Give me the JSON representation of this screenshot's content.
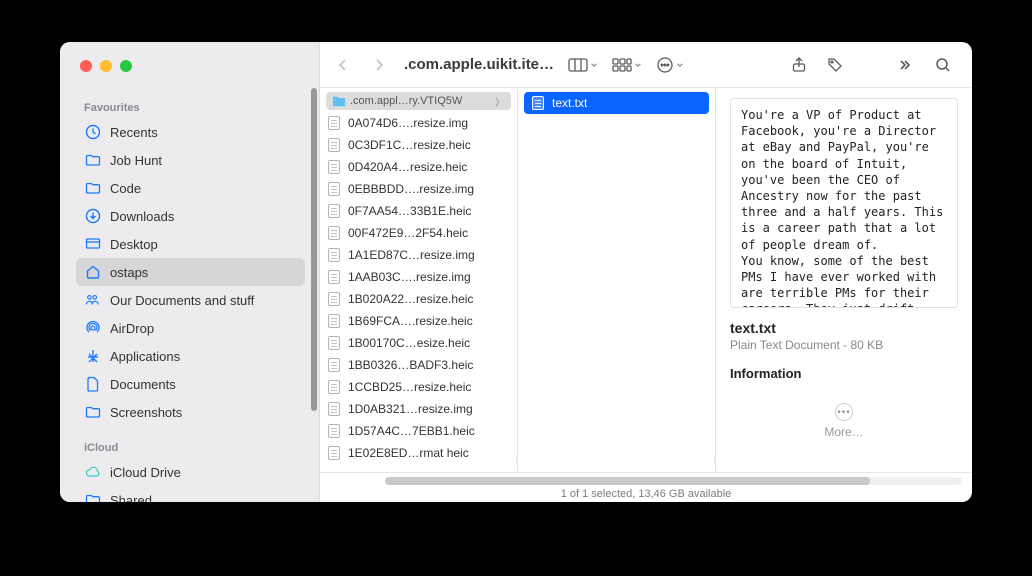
{
  "window_title": ".com.apple.uikit.ite…",
  "sidebar": {
    "sections": [
      {
        "header": "Favourites",
        "items": [
          {
            "icon": "clock",
            "label": "Recents"
          },
          {
            "icon": "folder",
            "label": "Job Hunt"
          },
          {
            "icon": "folder",
            "label": "Code"
          },
          {
            "icon": "download",
            "label": "Downloads"
          },
          {
            "icon": "desktop",
            "label": "Desktop"
          },
          {
            "icon": "home",
            "label": "ostaps",
            "selected": true
          },
          {
            "icon": "people",
            "label": "Our Documents and stuff"
          },
          {
            "icon": "airdrop",
            "label": "AirDrop"
          },
          {
            "icon": "apps",
            "label": "Applications"
          },
          {
            "icon": "doc",
            "label": "Documents"
          },
          {
            "icon": "folder",
            "label": "Screenshots"
          }
        ]
      },
      {
        "header": "iCloud",
        "items": [
          {
            "icon": "cloud",
            "label": "iCloud Drive"
          },
          {
            "icon": "folder",
            "label": "Shared"
          }
        ]
      }
    ]
  },
  "columns": {
    "path_header": ".com.appl…ry.VTIQ5W",
    "col1": [
      "0A074D6….resize.img",
      "0C3DF1C…resize.heic",
      "0D420A4…resize.heic",
      "0EBBBDD….resize.img",
      "0F7AA54…33B1E.heic",
      "00F472E9…2F54.heic",
      "1A1ED87C…resize.img",
      "1AAB03C….resize.img",
      "1B020A22…resize.heic",
      "1B69FCA….resize.heic",
      "1B00170C…esize.heic",
      "1BB0326…BADF3.heic",
      "1CCBD25…resize.heic",
      "1D0AB321…resize.img",
      "1D57A4C…7EBB1.heic",
      "1E02E8ED…rmat heic"
    ],
    "col2": [
      {
        "name": "text.txt",
        "selected": true
      }
    ]
  },
  "preview": {
    "content": "You're a VP of Product at Facebook, you're a Director at eBay and PayPal, you're on the board of Intuit, you've been the CEO of Ancestry now for the past three and a half years. This is a career path that a lot of people dream of.\nYou know, some of the best PMs I have ever worked with are terrible PMs for their careers. They just drift from job to job",
    "filename": "text.txt",
    "kind_size": "Plain Text Document - 80 KB",
    "info_header": "Information",
    "more_label": "More…"
  },
  "status": "1 of 1 selected, 13,46 GB available"
}
